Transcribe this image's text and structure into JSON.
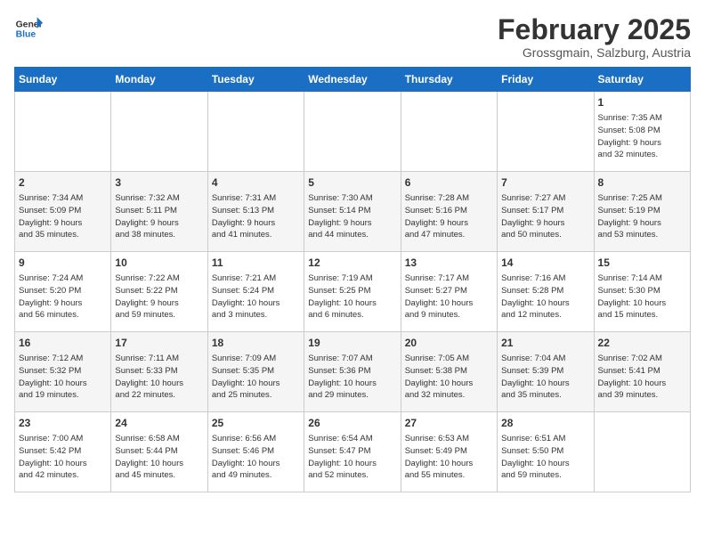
{
  "header": {
    "logo_line1": "General",
    "logo_line2": "Blue",
    "month_year": "February 2025",
    "location": "Grossgmain, Salzburg, Austria"
  },
  "days_of_week": [
    "Sunday",
    "Monday",
    "Tuesday",
    "Wednesday",
    "Thursday",
    "Friday",
    "Saturday"
  ],
  "weeks": [
    [
      {
        "day": "",
        "info": ""
      },
      {
        "day": "",
        "info": ""
      },
      {
        "day": "",
        "info": ""
      },
      {
        "day": "",
        "info": ""
      },
      {
        "day": "",
        "info": ""
      },
      {
        "day": "",
        "info": ""
      },
      {
        "day": "1",
        "info": "Sunrise: 7:35 AM\nSunset: 5:08 PM\nDaylight: 9 hours\nand 32 minutes."
      }
    ],
    [
      {
        "day": "2",
        "info": "Sunrise: 7:34 AM\nSunset: 5:09 PM\nDaylight: 9 hours\nand 35 minutes."
      },
      {
        "day": "3",
        "info": "Sunrise: 7:32 AM\nSunset: 5:11 PM\nDaylight: 9 hours\nand 38 minutes."
      },
      {
        "day": "4",
        "info": "Sunrise: 7:31 AM\nSunset: 5:13 PM\nDaylight: 9 hours\nand 41 minutes."
      },
      {
        "day": "5",
        "info": "Sunrise: 7:30 AM\nSunset: 5:14 PM\nDaylight: 9 hours\nand 44 minutes."
      },
      {
        "day": "6",
        "info": "Sunrise: 7:28 AM\nSunset: 5:16 PM\nDaylight: 9 hours\nand 47 minutes."
      },
      {
        "day": "7",
        "info": "Sunrise: 7:27 AM\nSunset: 5:17 PM\nDaylight: 9 hours\nand 50 minutes."
      },
      {
        "day": "8",
        "info": "Sunrise: 7:25 AM\nSunset: 5:19 PM\nDaylight: 9 hours\nand 53 minutes."
      }
    ],
    [
      {
        "day": "9",
        "info": "Sunrise: 7:24 AM\nSunset: 5:20 PM\nDaylight: 9 hours\nand 56 minutes."
      },
      {
        "day": "10",
        "info": "Sunrise: 7:22 AM\nSunset: 5:22 PM\nDaylight: 9 hours\nand 59 minutes."
      },
      {
        "day": "11",
        "info": "Sunrise: 7:21 AM\nSunset: 5:24 PM\nDaylight: 10 hours\nand 3 minutes."
      },
      {
        "day": "12",
        "info": "Sunrise: 7:19 AM\nSunset: 5:25 PM\nDaylight: 10 hours\nand 6 minutes."
      },
      {
        "day": "13",
        "info": "Sunrise: 7:17 AM\nSunset: 5:27 PM\nDaylight: 10 hours\nand 9 minutes."
      },
      {
        "day": "14",
        "info": "Sunrise: 7:16 AM\nSunset: 5:28 PM\nDaylight: 10 hours\nand 12 minutes."
      },
      {
        "day": "15",
        "info": "Sunrise: 7:14 AM\nSunset: 5:30 PM\nDaylight: 10 hours\nand 15 minutes."
      }
    ],
    [
      {
        "day": "16",
        "info": "Sunrise: 7:12 AM\nSunset: 5:32 PM\nDaylight: 10 hours\nand 19 minutes."
      },
      {
        "day": "17",
        "info": "Sunrise: 7:11 AM\nSunset: 5:33 PM\nDaylight: 10 hours\nand 22 minutes."
      },
      {
        "day": "18",
        "info": "Sunrise: 7:09 AM\nSunset: 5:35 PM\nDaylight: 10 hours\nand 25 minutes."
      },
      {
        "day": "19",
        "info": "Sunrise: 7:07 AM\nSunset: 5:36 PM\nDaylight: 10 hours\nand 29 minutes."
      },
      {
        "day": "20",
        "info": "Sunrise: 7:05 AM\nSunset: 5:38 PM\nDaylight: 10 hours\nand 32 minutes."
      },
      {
        "day": "21",
        "info": "Sunrise: 7:04 AM\nSunset: 5:39 PM\nDaylight: 10 hours\nand 35 minutes."
      },
      {
        "day": "22",
        "info": "Sunrise: 7:02 AM\nSunset: 5:41 PM\nDaylight: 10 hours\nand 39 minutes."
      }
    ],
    [
      {
        "day": "23",
        "info": "Sunrise: 7:00 AM\nSunset: 5:42 PM\nDaylight: 10 hours\nand 42 minutes."
      },
      {
        "day": "24",
        "info": "Sunrise: 6:58 AM\nSunset: 5:44 PM\nDaylight: 10 hours\nand 45 minutes."
      },
      {
        "day": "25",
        "info": "Sunrise: 6:56 AM\nSunset: 5:46 PM\nDaylight: 10 hours\nand 49 minutes."
      },
      {
        "day": "26",
        "info": "Sunrise: 6:54 AM\nSunset: 5:47 PM\nDaylight: 10 hours\nand 52 minutes."
      },
      {
        "day": "27",
        "info": "Sunrise: 6:53 AM\nSunset: 5:49 PM\nDaylight: 10 hours\nand 55 minutes."
      },
      {
        "day": "28",
        "info": "Sunrise: 6:51 AM\nSunset: 5:50 PM\nDaylight: 10 hours\nand 59 minutes."
      },
      {
        "day": "",
        "info": ""
      }
    ]
  ]
}
